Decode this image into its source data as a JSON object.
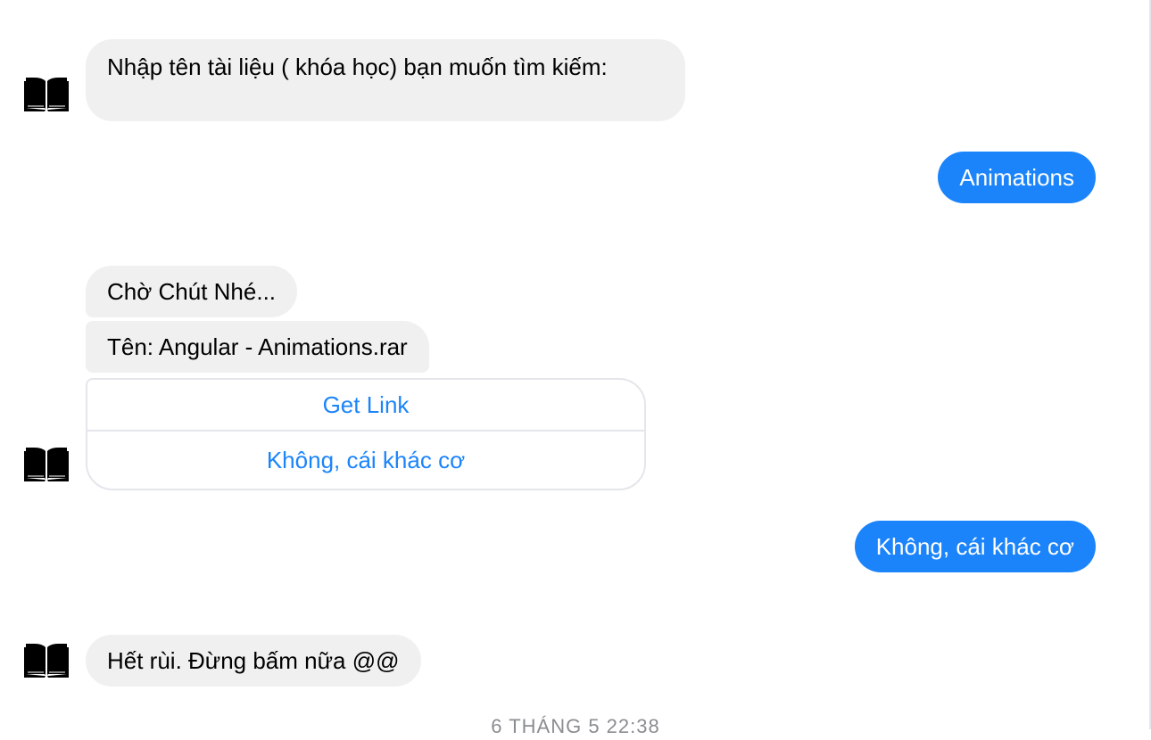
{
  "conversation": {
    "messages": [
      {
        "sender": "bot",
        "text": "Nhập tên tài liệu ( khóa học) bạn muốn tìm kiếm:"
      },
      {
        "sender": "user",
        "text": "Animations"
      },
      {
        "sender": "bot",
        "text": "Chờ Chút Nhé..."
      },
      {
        "sender": "bot",
        "text": "Tên: Angular - Animations.rar"
      },
      {
        "sender": "user",
        "text": "Không, cái khác cơ"
      },
      {
        "sender": "bot",
        "text": "Hết rùi. Đừng bấm nữa @@"
      }
    ],
    "buttons": {
      "get_link": "Get Link",
      "other": "Không, cái khác cơ"
    },
    "timestamp": "6 THÁNG 5 22:38"
  },
  "avatar_icon": "open-book-icon",
  "colors": {
    "incoming_bubble": "#f0f0f0",
    "outgoing_bubble": "#1b84fb",
    "button_text": "#1b84fb",
    "timestamp_text": "#8a8d91",
    "border": "#e4e6eb"
  }
}
